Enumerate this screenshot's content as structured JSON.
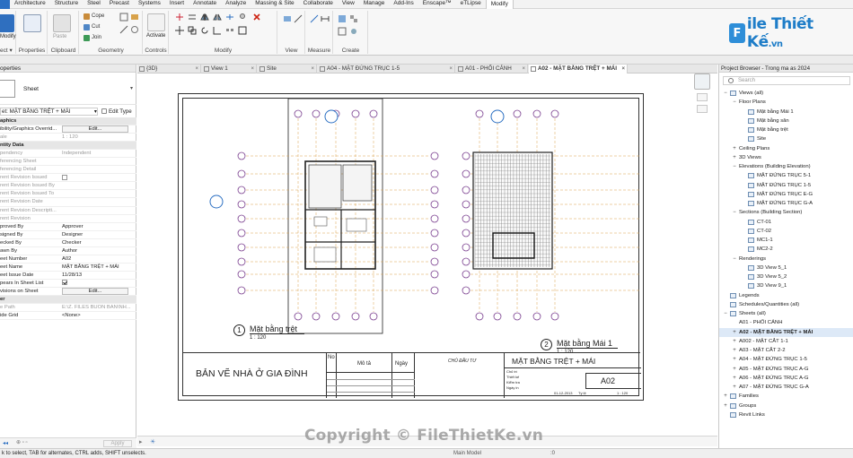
{
  "menu": {
    "file": "",
    "items": [
      "Architecture",
      "Structure",
      "Steel",
      "Precast",
      "Systems",
      "Insert",
      "Annotate",
      "Analyze",
      "Massing & Site",
      "Collaborate",
      "View",
      "Manage",
      "Add-Ins",
      "Enscape™",
      "eTLipse",
      "Modify"
    ],
    "active_index": 15
  },
  "ribbon": {
    "modify": "Modify",
    "select": "ect ▾",
    "properties": "Properties",
    "clipboard": "Clipboard",
    "paste": "Paste",
    "cope": "Cope",
    "cut": "Cut",
    "join": "Join",
    "geometry": "Geometry",
    "activate": "Activate",
    "controls": "Controls",
    "modify_group": "Modify",
    "view": "View",
    "measure": "Measure",
    "create": "Create"
  },
  "logo": {
    "mark": "F",
    "brand": "ile Thiết Kế",
    "domain": ".vn"
  },
  "properties": {
    "header": "operties",
    "type_name": "Sheet",
    "selector": "et: MẶT BẰNG TRỆT + MÁI",
    "edit_type": "Edit Type",
    "rows": [
      {
        "n": "aphics",
        "v": "",
        "kind": "group"
      },
      {
        "n": "ibility/Graphics Overrid...",
        "v": "Edit...",
        "kind": "button"
      },
      {
        "n": "ale",
        "v": "1 : 120",
        "kind": "dim"
      },
      {
        "n": "ntity Data",
        "v": "",
        "kind": "group"
      },
      {
        "n": "pendency",
        "v": "Independent",
        "kind": "dim"
      },
      {
        "n": "ferencing Sheet",
        "v": "",
        "kind": "dim"
      },
      {
        "n": "ferencing Detail",
        "v": "",
        "kind": "dim"
      },
      {
        "n": "rent Revision Issued",
        "v": "",
        "kind": "dimcheck"
      },
      {
        "n": "rent Revision Issued By",
        "v": "",
        "kind": "dim"
      },
      {
        "n": "rent Revision Issued To",
        "v": "",
        "kind": "dim"
      },
      {
        "n": "rent Revision Date",
        "v": "",
        "kind": "dim"
      },
      {
        "n": "rent Revision Descripti...",
        "v": "",
        "kind": "dim"
      },
      {
        "n": "rent Revision",
        "v": "",
        "kind": "dim"
      },
      {
        "n": "proved By",
        "v": "Approver",
        "kind": "normal"
      },
      {
        "n": "signed By",
        "v": "Designer",
        "kind": "normal"
      },
      {
        "n": "ecked By",
        "v": "Checker",
        "kind": "normal"
      },
      {
        "n": "awn By",
        "v": "Author",
        "kind": "normal"
      },
      {
        "n": "eet Number",
        "v": "A02",
        "kind": "normal"
      },
      {
        "n": "eet Name",
        "v": "MẶT BẰNG TRỆT + MÁI",
        "kind": "normal"
      },
      {
        "n": "eet Issue Date",
        "v": "11/28/13",
        "kind": "normal"
      },
      {
        "n": "pears In Sheet List",
        "v": "",
        "kind": "check"
      },
      {
        "n": "visions on Sheet",
        "v": "Edit...",
        "kind": "button"
      },
      {
        "n": "er",
        "v": "",
        "kind": "group"
      },
      {
        "n": "e Path",
        "v": "E:\\Z. FILES BUON BAN\\NH...",
        "kind": "dim"
      },
      {
        "n": "ide Grid",
        "v": "<None>",
        "kind": "normal"
      }
    ],
    "apply": "Apply"
  },
  "tabs": [
    {
      "label": "{3D}",
      "active": false
    },
    {
      "label": "View 1",
      "active": false
    },
    {
      "label": "Site",
      "active": false
    },
    {
      "label": "A04 - MẶT ĐỨNG TRỤC 1-5",
      "active": false
    },
    {
      "label": "A01 - PHỐI CẢNH",
      "active": false
    },
    {
      "label": "A02 - MẶT BẰNG TRỆT + MÁI",
      "active": true
    }
  ],
  "sheet": {
    "plan1": {
      "num": "1",
      "title": "Mặt bằng trệt",
      "scale": "1 : 120"
    },
    "plan2": {
      "num": "2",
      "title": "Mặt bằng Mái 1",
      "scale": "1 : 120"
    },
    "project_title": "BẢN VẼ NHÀ Ở GIA ĐÌNH",
    "no": "No",
    "mota": "Mô tả",
    "ngay": "Ngày",
    "chudautu": "CHỦ ĐẦU TƯ",
    "sheet_title": "MẶT BẰNG TRỆT + MÁI",
    "sheet_number": "A02",
    "fields": [
      "Chủ trì",
      "Thiết kế",
      "Kiểm tra",
      "Ngày in"
    ],
    "date": "01-12-2013",
    "scale_label": "Tỷ lệ",
    "scale_value": "1 : 120"
  },
  "browser": {
    "header": "Project Browser - Trong ma as 2024",
    "search_placeholder": "Search",
    "nodes": [
      {
        "label": "Views (all)",
        "level": 0,
        "toggle": "−",
        "icon": true
      },
      {
        "label": "Floor Plans",
        "level": 1,
        "toggle": "−",
        "icon": false
      },
      {
        "label": "Mặt bằng Mái 1",
        "level": 2,
        "toggle": "",
        "icon": true
      },
      {
        "label": "Mặt bằng sân",
        "level": 2,
        "toggle": "",
        "icon": true
      },
      {
        "label": "Mặt bằng trệt",
        "level": 2,
        "toggle": "",
        "icon": true
      },
      {
        "label": "Site",
        "level": 2,
        "toggle": "",
        "icon": true
      },
      {
        "label": "Ceiling Plans",
        "level": 1,
        "toggle": "+",
        "icon": false
      },
      {
        "label": "3D Views",
        "level": 1,
        "toggle": "+",
        "icon": false
      },
      {
        "label": "Elevations (Building Elevation)",
        "level": 1,
        "toggle": "−",
        "icon": false
      },
      {
        "label": "MẶT ĐỨNG TRỤC 5-1",
        "level": 2,
        "toggle": "",
        "icon": true
      },
      {
        "label": "MẶT ĐỨNG TRỤC 1-5",
        "level": 2,
        "toggle": "",
        "icon": true
      },
      {
        "label": "MẶT ĐỨNG TRỤC E-G",
        "level": 2,
        "toggle": "",
        "icon": true
      },
      {
        "label": "MẶT ĐỨNG TRỤC G-A",
        "level": 2,
        "toggle": "",
        "icon": true
      },
      {
        "label": "Sections (Building Section)",
        "level": 1,
        "toggle": "−",
        "icon": false
      },
      {
        "label": "CT-01",
        "level": 2,
        "toggle": "",
        "icon": true
      },
      {
        "label": "CT-02",
        "level": 2,
        "toggle": "",
        "icon": true
      },
      {
        "label": "MC1-1",
        "level": 2,
        "toggle": "",
        "icon": true
      },
      {
        "label": "MC2-2",
        "level": 2,
        "toggle": "",
        "icon": true
      },
      {
        "label": "Renderings",
        "level": 1,
        "toggle": "−",
        "icon": false
      },
      {
        "label": "3D View 5_1",
        "level": 2,
        "toggle": "",
        "icon": true
      },
      {
        "label": "3D View 5_2",
        "level": 2,
        "toggle": "",
        "icon": true
      },
      {
        "label": "3D View 9_1",
        "level": 2,
        "toggle": "",
        "icon": true
      },
      {
        "label": "Legends",
        "level": 0,
        "toggle": "",
        "icon": true
      },
      {
        "label": "Schedules/Quantities (all)",
        "level": 0,
        "toggle": "",
        "icon": true
      },
      {
        "label": "Sheets (all)",
        "level": 0,
        "toggle": "−",
        "icon": true
      },
      {
        "label": "A01 - PHỐI CẢNH",
        "level": 1,
        "toggle": "",
        "icon": false
      },
      {
        "label": "A02 - MẶT BẰNG TRỆT + MÁI",
        "level": 1,
        "toggle": "+",
        "icon": false,
        "selected": true
      },
      {
        "label": "A002 - MẶT CẮT 1-1",
        "level": 1,
        "toggle": "+",
        "icon": false
      },
      {
        "label": "A03 - MẶT CẮT 2-2",
        "level": 1,
        "toggle": "+",
        "icon": false
      },
      {
        "label": "A04 - MẶT ĐỨNG TRỤC 1-5",
        "level": 1,
        "toggle": "+",
        "icon": false
      },
      {
        "label": "A05 - MẶT ĐỨNG TRỤC A-G",
        "level": 1,
        "toggle": "+",
        "icon": false
      },
      {
        "label": "A06 - MẶT ĐỨNG TRỤC A-G",
        "level": 1,
        "toggle": "+",
        "icon": false
      },
      {
        "label": "A07 - MẶT ĐỨNG TRỤC G-A",
        "level": 1,
        "toggle": "+",
        "icon": false
      },
      {
        "label": "Families",
        "level": 0,
        "toggle": "+",
        "icon": true
      },
      {
        "label": "Groups",
        "level": 0,
        "toggle": "+",
        "icon": true
      },
      {
        "label": "Revit Links",
        "level": 0,
        "toggle": "",
        "icon": true
      }
    ]
  },
  "status": {
    "text": "k to select, TAB for alternates, CTRL adds, SHIFT unselects.",
    "model": "Main Model",
    "zero": ":0"
  },
  "watermark": "Copyright © FileThietKe.vn",
  "colors": {
    "accent": "#2b6fc2",
    "brand": "#1e7dc8",
    "selection": "#dde9f7",
    "drawing_orange": "#d9a04a",
    "drawing_purple": "#7a3f8f"
  }
}
